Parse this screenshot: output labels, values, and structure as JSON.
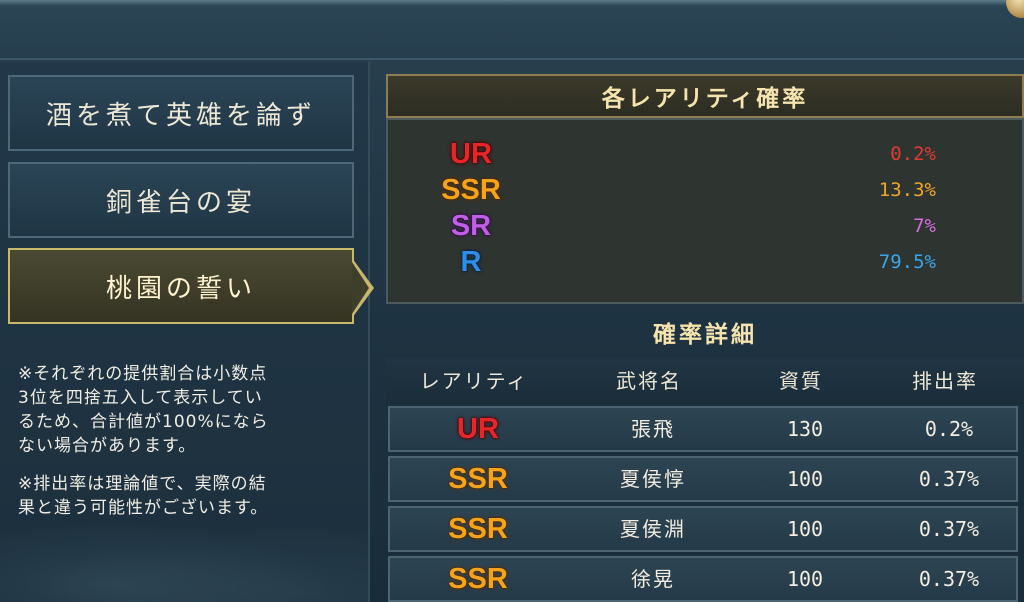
{
  "tabs": [
    {
      "label": "酒を煮て英雄を論ず",
      "active": false
    },
    {
      "label": "銅雀台の宴",
      "active": false
    },
    {
      "label": "桃園の誓い",
      "active": true
    }
  ],
  "notes": [
    "※それぞれの提供割合は小数点\n3位を四捨五入して表示してい\nるため、合計値が100%になら\nない場合があります。",
    "※排出率は理論値で、実際の結\n果と違う可能性がございます。"
  ],
  "rarity_rates": {
    "title": "各レアリティ確率",
    "rows": [
      {
        "rarity": "UR",
        "rate": "0.2%"
      },
      {
        "rarity": "SSR",
        "rate": "13.3%"
      },
      {
        "rarity": "SR",
        "rate": "7%"
      },
      {
        "rarity": "R",
        "rate": "79.5%"
      }
    ]
  },
  "details": {
    "title": "確率詳細",
    "columns": [
      "レアリティ",
      "武将名",
      "資質",
      "排出率"
    ],
    "rows": [
      {
        "rarity": "UR",
        "name": "張飛",
        "quality": "130",
        "rate": "0.2%"
      },
      {
        "rarity": "SSR",
        "name": "夏侯惇",
        "quality": "100",
        "rate": "0.37%"
      },
      {
        "rarity": "SSR",
        "name": "夏侯淵",
        "quality": "100",
        "rate": "0.37%"
      },
      {
        "rarity": "SSR",
        "name": "徐晃",
        "quality": "100",
        "rate": "0.37%"
      }
    ]
  },
  "colors": {
    "UR": "#e8262a",
    "SSR": "#f5a31a",
    "SR": "#c05ee6",
    "R": "#2f8ce8",
    "accent_gold": "#c9b76a"
  }
}
